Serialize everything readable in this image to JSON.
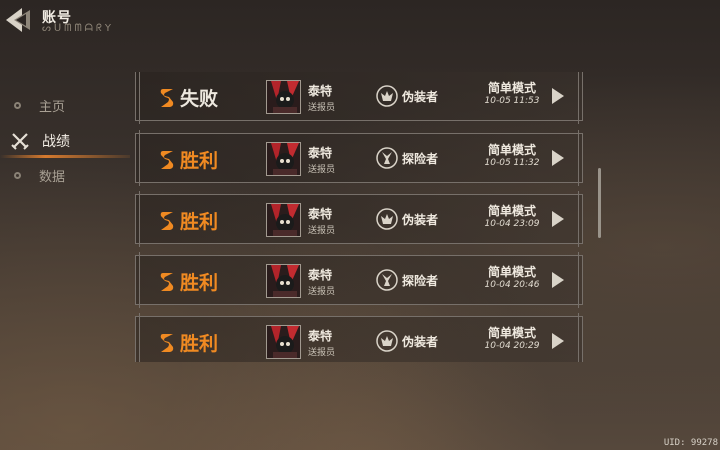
{
  "header": {
    "title": "账号",
    "subtitle": "ᔕᑌᗰᗰᗩᖇY"
  },
  "sidebar": {
    "items": [
      {
        "label": "主页",
        "icon": "circle-icon",
        "active": false
      },
      {
        "label": "战绩",
        "icon": "crossed-swords-icon",
        "active": true
      },
      {
        "label": "数据",
        "icon": "circle-icon",
        "active": false
      }
    ]
  },
  "records": [
    {
      "result": "失败",
      "outcome": "lose",
      "name": "泰特",
      "role": "送报员",
      "camp": "伪装者",
      "mode": "简单模式",
      "time": "10-05 11:53"
    },
    {
      "result": "胜利",
      "outcome": "win",
      "name": "泰特",
      "role": "送报员",
      "camp": "探险者",
      "mode": "简单模式",
      "time": "10-05 11:32"
    },
    {
      "result": "胜利",
      "outcome": "win",
      "name": "泰特",
      "role": "送报员",
      "camp": "伪装者",
      "mode": "简单模式",
      "time": "10-04 23:09"
    },
    {
      "result": "胜利",
      "outcome": "win",
      "name": "泰特",
      "role": "送报员",
      "camp": "探险者",
      "mode": "简单模式",
      "time": "10-04 20:46"
    },
    {
      "result": "胜利",
      "outcome": "win",
      "name": "泰特",
      "role": "送报员",
      "camp": "伪装者",
      "mode": "简单模式",
      "time": "10-04 20:29"
    }
  ],
  "footer": {
    "uid": "UID: 99278"
  },
  "colors": {
    "accent": "#f08a22",
    "text": "#efe9df",
    "border": "#77706a"
  }
}
